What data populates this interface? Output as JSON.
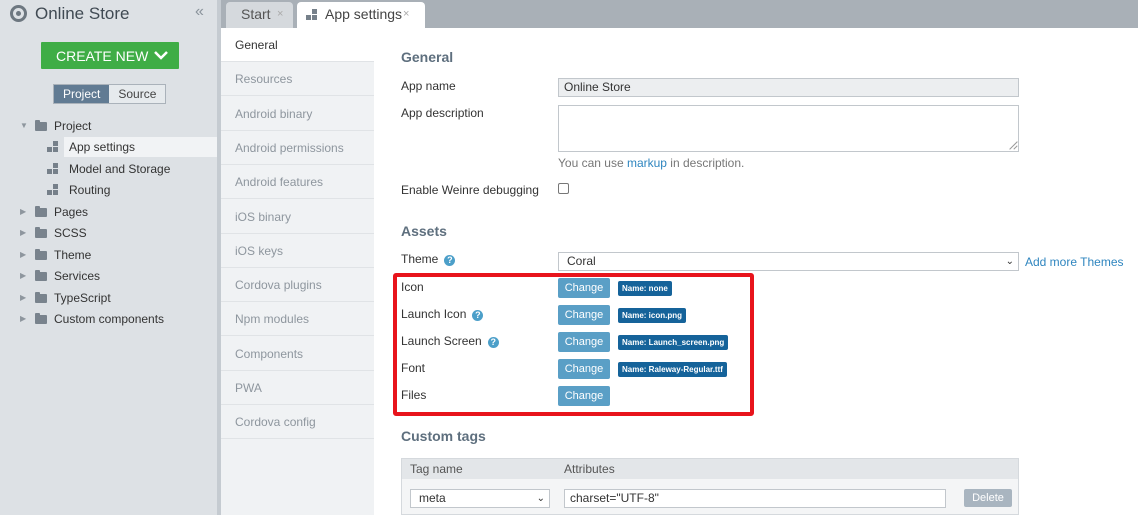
{
  "app": {
    "title": "Online Store",
    "collapse_glyph": "«"
  },
  "sidebar": {
    "create_label": "CREATE NEW",
    "create_chevron": "⌄",
    "switch": {
      "project": "Project",
      "source": "Source"
    },
    "tree": [
      {
        "label": "Project",
        "kind": "folder",
        "expanded": true
      },
      {
        "label": "App settings",
        "kind": "file",
        "selected": true
      },
      {
        "label": "Model and Storage",
        "kind": "file"
      },
      {
        "label": "Routing",
        "kind": "file"
      },
      {
        "label": "Pages",
        "kind": "folder"
      },
      {
        "label": "SCSS",
        "kind": "folder"
      },
      {
        "label": "Theme",
        "kind": "folder"
      },
      {
        "label": "Services",
        "kind": "folder"
      },
      {
        "label": "TypeScript",
        "kind": "folder"
      },
      {
        "label": "Custom components",
        "kind": "folder"
      }
    ]
  },
  "tabs": [
    {
      "label": "Start",
      "close": "×"
    },
    {
      "label": "App settings",
      "close": "×",
      "active": true
    }
  ],
  "settings_nav": [
    "General",
    "Resources",
    "Android binary",
    "Android permissions",
    "Android features",
    "iOS binary",
    "iOS keys",
    "Cordova plugins",
    "Npm modules",
    "Components",
    "PWA",
    "Cordova config"
  ],
  "general": {
    "title": "General",
    "app_name_label": "App name",
    "app_name_value": "Online Store",
    "app_description_label": "App description",
    "app_description_value": "",
    "hint_before": "You can use ",
    "hint_link": "markup",
    "hint_after": " in description.",
    "weinre_label": "Enable Weinre debugging",
    "weinre_checked": false
  },
  "assets": {
    "title": "Assets",
    "theme_label": "Theme",
    "help_glyph": "?",
    "theme_value": "Coral",
    "select_caret": "⌄",
    "add_themes_link": "Add more Themes",
    "change_label": "Change",
    "rows": [
      {
        "label": "Icon",
        "badge": "Name: none",
        "help": false
      },
      {
        "label": "Launch Icon",
        "badge": "Name: icon.png",
        "help": true
      },
      {
        "label": "Launch Screen",
        "badge": "Name: Launch_screen.png",
        "help": true
      },
      {
        "label": "Font",
        "badge": "Name: Raleway-Regular.ttf",
        "help": false
      },
      {
        "label": "Files",
        "badge": "",
        "help": false
      }
    ]
  },
  "custom_tags": {
    "title": "Custom tags",
    "col_tag": "Tag name",
    "col_attr": "Attributes",
    "row": {
      "tag": "meta",
      "attributes": "charset=\"UTF-8\"",
      "delete_label": "Delete"
    }
  },
  "colors": {
    "accent": "#3fad46",
    "link": "#2e85bf",
    "highlight": "#e8141c",
    "badge": "#15639a"
  }
}
